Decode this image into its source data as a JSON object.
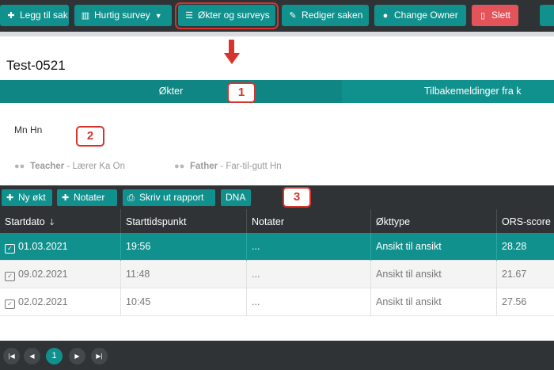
{
  "toolbar": {
    "add_case": "Legg til sak",
    "quick_survey": "Hurtig survey",
    "sessions_surveys": "Økter og surveys",
    "edit_case": "Rediger saken",
    "change_owner": "Change Owner",
    "delete": "Slett"
  },
  "case": {
    "title": "Test-0521"
  },
  "tabs": {
    "sessions": "Økter",
    "feedback": "Tilbakemeldinger fra k"
  },
  "annotations": {
    "badge1": "1",
    "badge2": "2",
    "badge3": "3"
  },
  "client": {
    "name": "Mn Hn",
    "relations": [
      {
        "role": "Teacher",
        "detail": "Lærer Ka On"
      },
      {
        "role": "Father",
        "detail": "Far-til-gutt Hn"
      }
    ]
  },
  "session_toolbar": {
    "new_session": "Ny økt",
    "notes": "Notater",
    "print_report": "Skriv ut rapport",
    "dna": "DNA"
  },
  "table": {
    "headers": {
      "start_date": "Startdato",
      "start_time": "Starttidspunkt",
      "notes": "Notater",
      "session_type": "Økttype",
      "ors_score": "ORS-score"
    },
    "rows": [
      {
        "date": "01.03.2021",
        "time": "19:56",
        "notes": "...",
        "type": "Ansikt til ansikt",
        "ors": "28.28"
      },
      {
        "date": "09.02.2021",
        "time": "11:48",
        "notes": "...",
        "type": "Ansikt til ansikt",
        "ors": "21.67"
      },
      {
        "date": "02.02.2021",
        "time": "10:45",
        "notes": "...",
        "type": "Ansikt til ansikt",
        "ors": "27.56"
      }
    ]
  },
  "pager": {
    "current_page": "1"
  },
  "colors": {
    "teal": "#11918e",
    "dark": "#2f3336",
    "red": "#e2535a",
    "annotation": "#d8342e"
  }
}
